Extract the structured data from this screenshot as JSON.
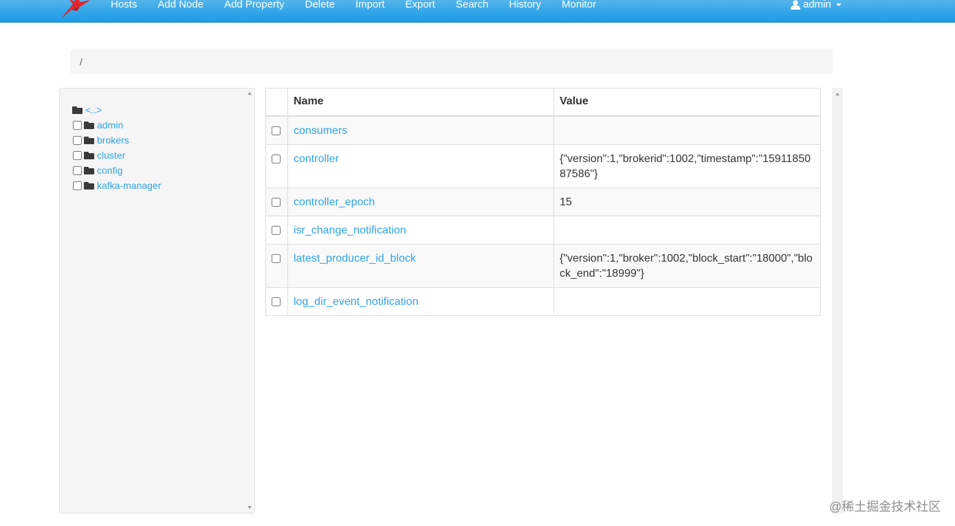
{
  "nav": {
    "items": [
      "Hosts",
      "Add Node",
      "Add Property",
      "Delete",
      "Import",
      "Export",
      "Search",
      "History",
      "Monitor"
    ],
    "user_label": "admin"
  },
  "breadcrumb": {
    "path": "/"
  },
  "tree": {
    "parent_label": "<..>",
    "items": [
      "admin",
      "brokers",
      "cluster",
      "config",
      "kafka-manager"
    ]
  },
  "table": {
    "headers": {
      "name": "Name",
      "value": "Value"
    },
    "rows": [
      {
        "name": "consumers",
        "value": ""
      },
      {
        "name": "controller",
        "value": "{\"version\":1,\"brokerid\":1002,\"timestamp\":\"1591185087586\"}"
      },
      {
        "name": "controller_epoch",
        "value": "15"
      },
      {
        "name": "isr_change_notification",
        "value": ""
      },
      {
        "name": "latest_producer_id_block",
        "value": "{\"version\":1,\"broker\":1002,\"block_start\":\"18000\",\"block_end\":\"18999\"}"
      },
      {
        "name": "log_dir_event_notification",
        "value": ""
      }
    ]
  },
  "watermark": "@稀土掘金技术社区",
  "colors": {
    "navbar": "#2fa4e7",
    "link": "#2fa4e7",
    "brand_bird": "#e0262b"
  }
}
